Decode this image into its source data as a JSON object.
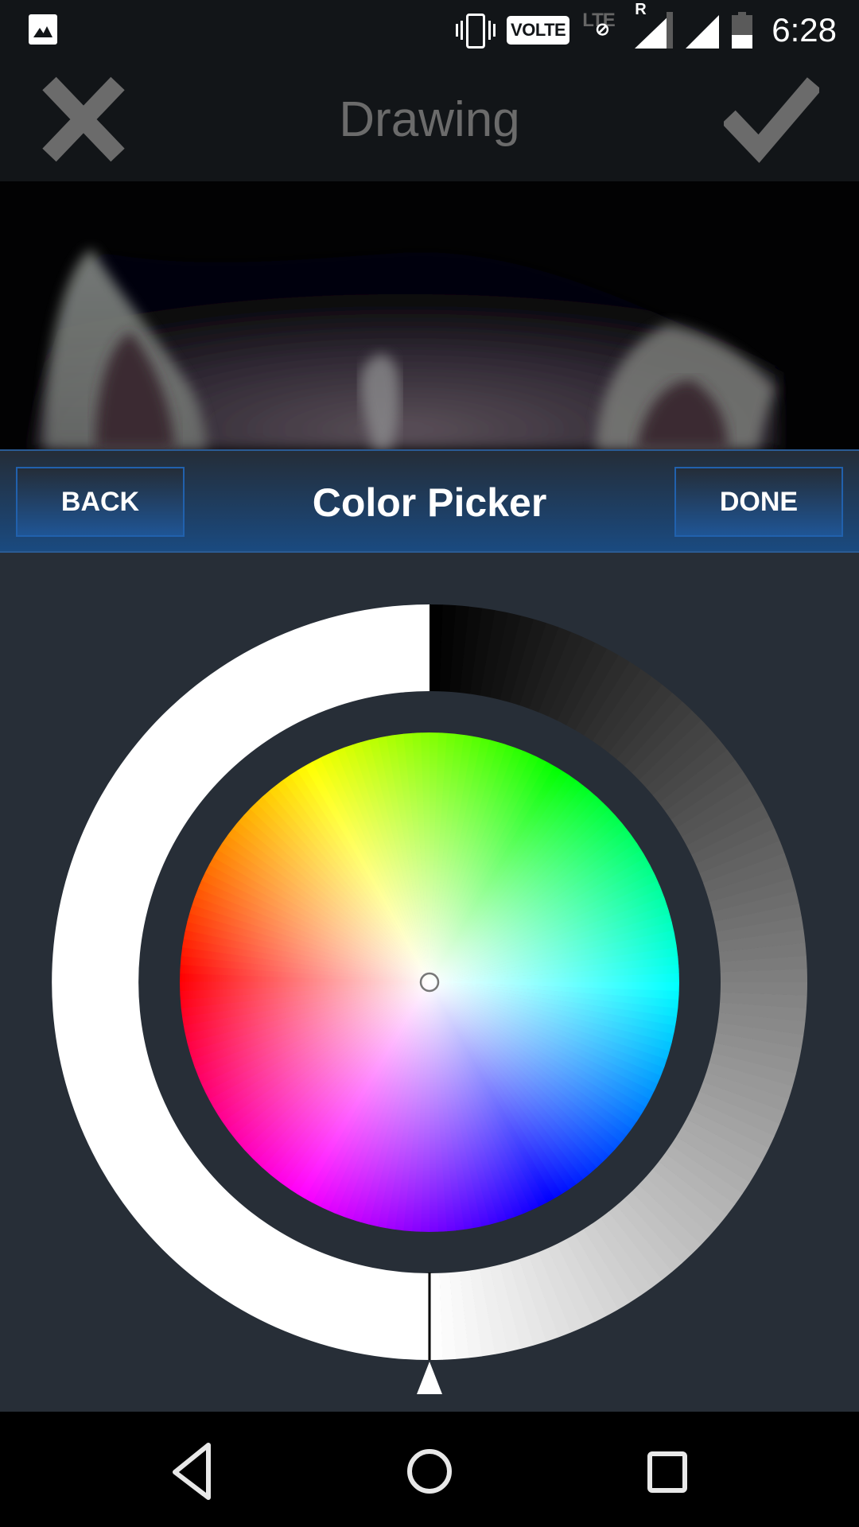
{
  "status_bar": {
    "time": "6:28",
    "icons": [
      "gallery-notification-icon",
      "vibrate-icon",
      "volte-icon",
      "lte-icon",
      "roaming-signal-icon",
      "signal-icon",
      "battery-icon"
    ],
    "volte_label": "VOLTE",
    "lte_label": "LTE",
    "roaming_label": "R",
    "battery_level": 0.4
  },
  "app_bar": {
    "title": "Drawing",
    "close_icon": "close-icon",
    "confirm_icon": "check-icon",
    "icon_color": "#6b6b6b"
  },
  "photo": {
    "description": "kitten-ears-photo"
  },
  "picker_header": {
    "title": "Color Picker",
    "back_label": "BACK",
    "done_label": "DONE",
    "accent": "#2161ad"
  },
  "color_picker": {
    "selected_hue_marker": "center",
    "selected_color": "#ffffff",
    "brightness_ring": {
      "left_half_color": "#ffffff",
      "right_half_gradient": [
        "#000000",
        "#ffffff"
      ]
    },
    "brightness_value": 1.0,
    "hue_wheel_stops": [
      "#ff0000",
      "#ffff00",
      "#00ff00",
      "#00ffff",
      "#0000ff",
      "#ff00ff"
    ]
  },
  "nav_bar": {
    "back_icon": "back-icon",
    "home_icon": "home-icon",
    "recents_icon": "recents-icon"
  }
}
